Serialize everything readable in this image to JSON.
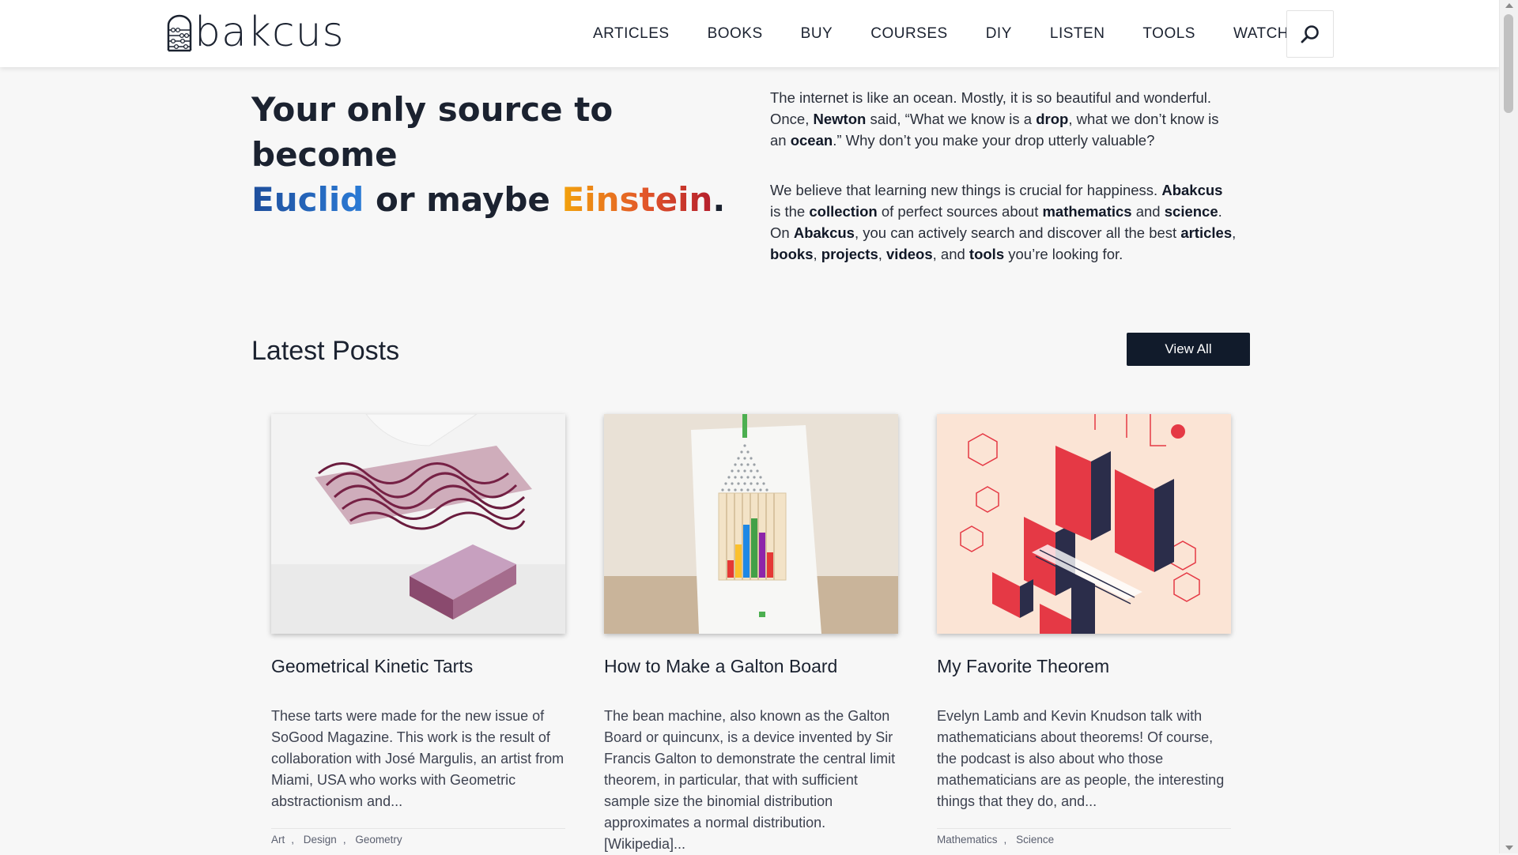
{
  "brand": {
    "name": "Abakcus"
  },
  "nav": {
    "items": [
      "ARTICLES",
      "BOOKS",
      "BUY",
      "COURSES",
      "DIY",
      "LISTEN",
      "TOOLS",
      "WATCH"
    ],
    "search_icon": "search-icon"
  },
  "hero": {
    "title_part1": "Your only source to become",
    "title_euclid": "Euclid",
    "title_mid": " or maybe ",
    "title_einstein": "Einstein",
    "title_end": "."
  },
  "intro": {
    "p1": [
      {
        "t": "The internet is like an ocean. Mostly, it is so beautiful and wonderful. Once, ",
        "b": false
      },
      {
        "t": "Newton",
        "b": true
      },
      {
        "t": " said, “What we know is a ",
        "b": false
      },
      {
        "t": "drop",
        "b": true
      },
      {
        "t": ", what we don’t know is an ",
        "b": false
      },
      {
        "t": "ocean",
        "b": true
      },
      {
        "t": ".” Why don’t you make your drop utterly valuable?",
        "b": false
      }
    ],
    "p2": [
      {
        "t": "We believe that learning new things is crucial for happiness. ",
        "b": false
      },
      {
        "t": "Abakcus",
        "b": true
      },
      {
        "t": " is the ",
        "b": false
      },
      {
        "t": "collection",
        "b": true
      },
      {
        "t": " of perfect sources about ",
        "b": false
      },
      {
        "t": "mathematics",
        "b": true
      },
      {
        "t": " and ",
        "b": false
      },
      {
        "t": "science",
        "b": true
      },
      {
        "t": ". On ",
        "b": false
      },
      {
        "t": "Abakcus",
        "b": true
      },
      {
        "t": ", you can actively search and discover all the best ",
        "b": false
      },
      {
        "t": "articles",
        "b": true
      },
      {
        "t": ", ",
        "b": false
      },
      {
        "t": "books",
        "b": true
      },
      {
        "t": ", ",
        "b": false
      },
      {
        "t": "projects",
        "b": true
      },
      {
        "t": ", ",
        "b": false
      },
      {
        "t": "videos",
        "b": true
      },
      {
        "t": ", and ",
        "b": false
      },
      {
        "t": "tools",
        "b": true
      },
      {
        "t": " you’re looking for.",
        "b": false
      }
    ]
  },
  "latest": {
    "title": "Latest Posts",
    "view_all": "View All",
    "posts": [
      {
        "title": "Geometrical Kinetic Tarts",
        "excerpt": "These tarts were made for the new issue of SoGood Magazine. This work is the result of collaboration with José Margulis, an artist from Miami, USA who works with Geometric abstractionism and...",
        "tags": [
          "Art",
          "Design",
          "Geometry"
        ]
      },
      {
        "title": "How to Make a Galton Board",
        "excerpt": "The bean machine, also known as the Galton Board or quincunx, is a device invented by Sir Francis Galton to demonstrate the central limit theorem, in particular, that with sufficient sample size the binomial distribution approximates a normal distribution. [Wikipedia]...",
        "tags": []
      },
      {
        "title": "My Favorite Theorem",
        "excerpt": "Evelyn Lamb and Kevin Knudson talk with mathematicians about theorems! Of course, the podcast is also about who those mathematicians are as people, the interesting things that they do, and...",
        "tags": [
          "Mathematics",
          "Science"
        ]
      }
    ]
  }
}
